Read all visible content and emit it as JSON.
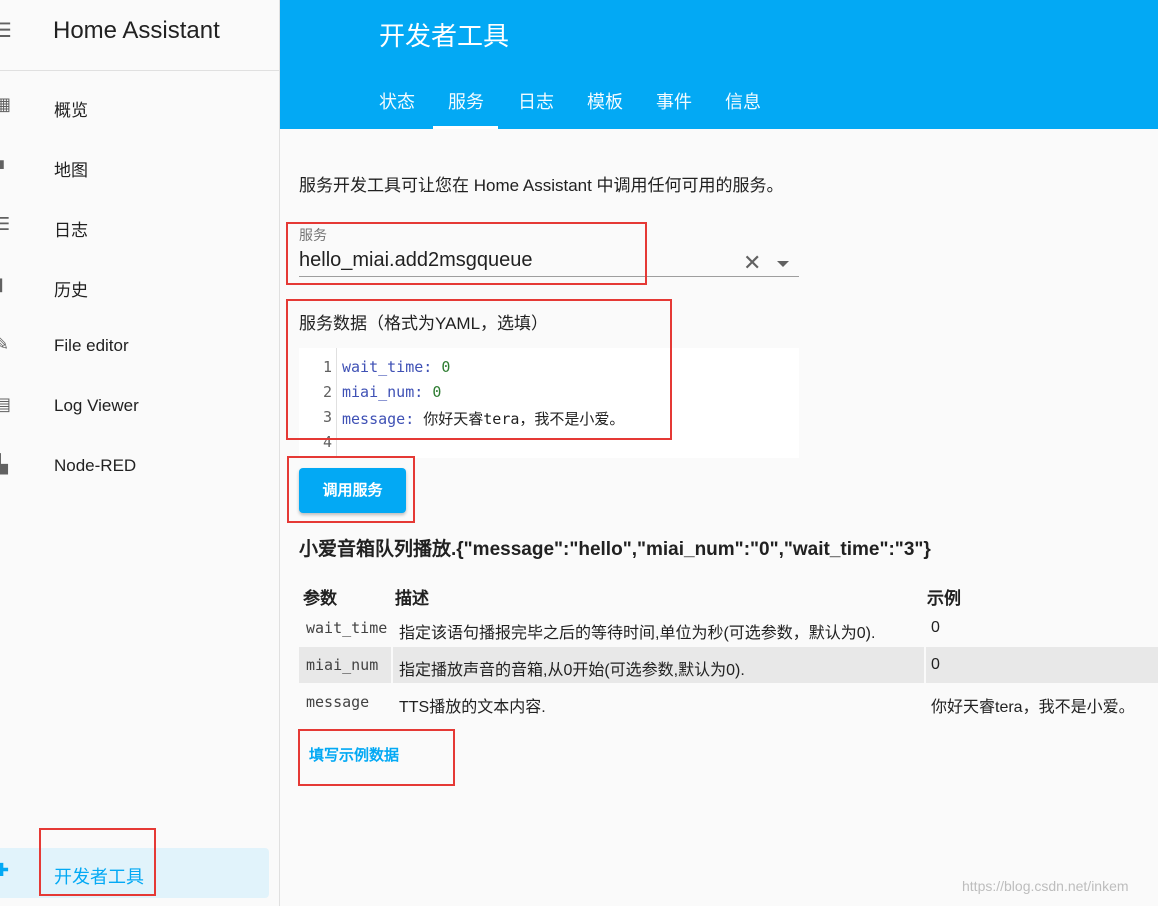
{
  "sidebar": {
    "title": "Home Assistant",
    "items": [
      {
        "label": "概览",
        "icon": "grid-icon"
      },
      {
        "label": "地图",
        "icon": "map-icon"
      },
      {
        "label": "日志",
        "icon": "list-icon"
      },
      {
        "label": "历史",
        "icon": "chart-icon"
      },
      {
        "label": "File editor",
        "icon": "wrench-icon"
      },
      {
        "label": "Log Viewer",
        "icon": "document-icon"
      },
      {
        "label": "Node-RED",
        "icon": "sitemap-icon"
      }
    ],
    "active_item": {
      "label": "开发者工具",
      "icon": "hammer-icon"
    }
  },
  "header": {
    "title": "开发者工具",
    "tabs": [
      "状态",
      "服务",
      "日志",
      "模板",
      "事件",
      "信息"
    ],
    "active_tab": "服务"
  },
  "main": {
    "intro": "服务开发工具可让您在 Home Assistant 中调用任何可用的服务。",
    "service_field": {
      "label": "服务",
      "value": "hello_miai.add2msgqueue"
    },
    "service_data_label": "服务数据（格式为YAML，选填）",
    "code_lines": [
      {
        "num": "1",
        "key": "wait_time",
        "value": "0"
      },
      {
        "num": "2",
        "key": "miai_num",
        "value": "0"
      },
      {
        "num": "3",
        "key": "message",
        "value": "你好天睿tera，我不是小爱。"
      },
      {
        "num": "4",
        "key": "",
        "value": ""
      }
    ],
    "call_button": "调用服务",
    "service_description": "小爱音箱队列播放.{\"message\":\"hello\",\"miai_num\":\"0\",\"wait_time\":\"3\"}",
    "table": {
      "headers": [
        "参数",
        "描述",
        "示例"
      ],
      "rows": [
        {
          "param": "wait_time",
          "desc": "指定该语句播报完毕之后的等待时间,单位为秒(可选参数，默认为0).",
          "example": "0"
        },
        {
          "param": "miai_num",
          "desc": "指定播放声音的音箱,从0开始(可选参数,默认为0).",
          "example": "0"
        },
        {
          "param": "message",
          "desc": "TTS播放的文本内容.",
          "example": "你好天睿tera，我不是小爱。"
        }
      ]
    },
    "fill_example_link": "填写示例数据"
  },
  "watermark": "https://blog.csdn.net/inkem",
  "colors": {
    "accent": "#03a9f4",
    "annotation": "#e53935"
  }
}
